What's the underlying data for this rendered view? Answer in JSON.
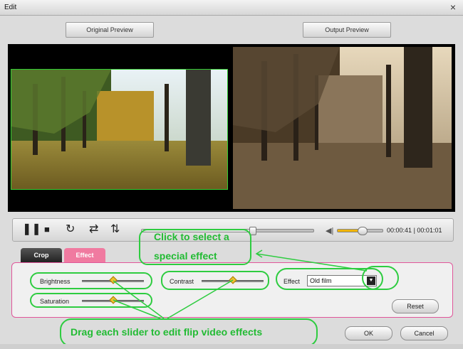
{
  "window": {
    "title": "Edit",
    "close_glyph": "×"
  },
  "preview": {
    "original_label": "Original Preview",
    "output_label": "Output Preview"
  },
  "playback": {
    "pause_glyph": "❚❚",
    "stop_glyph": "■",
    "repeat_glyph": "↻",
    "swap_glyph": "⇄",
    "flip_glyph": "⇅",
    "seek_progress": 0.65,
    "volume_level": 0.55,
    "time_current": "00:00:41",
    "time_total": "00:01:01",
    "time_separator": "|"
  },
  "tabs": {
    "crop": "Crop",
    "effect": "Effect"
  },
  "effects": {
    "brightness_label": "Brightness",
    "brightness_value": 0.5,
    "contrast_label": "Contrast",
    "contrast_value": 0.5,
    "saturation_label": "Saturation",
    "saturation_value": 0.5,
    "effect_label": "Effect",
    "effect_selected": "Old film",
    "reset_label": "Reset"
  },
  "dialog": {
    "ok_label": "OK",
    "cancel_label": "Cancel"
  },
  "annotations": {
    "select_effect_line1": "Click to select a",
    "select_effect_line2": "special effect",
    "drag_slider": "Drag each slider to edit flip video effects"
  },
  "colors": {
    "accent": "#f07aa0",
    "annotation": "#22bb33",
    "volume_fill": "#f0b400"
  }
}
